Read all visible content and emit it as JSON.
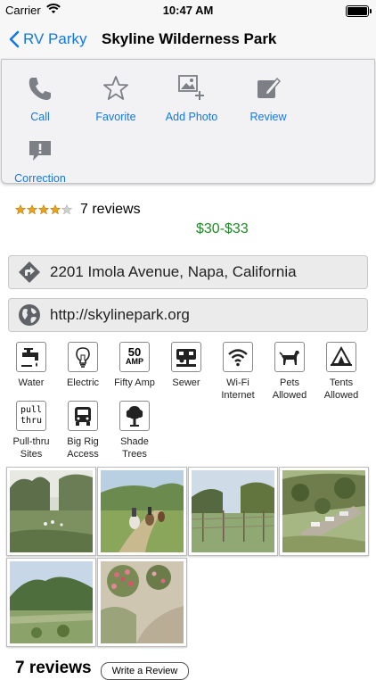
{
  "status_bar": {
    "carrier": "Carrier",
    "time": "10:47 AM"
  },
  "nav": {
    "back_label": "RV Parky",
    "title": "Skyline Wilderness Park"
  },
  "actions": [
    {
      "label": "Call",
      "icon": "phone-icon"
    },
    {
      "label": "Favorite",
      "icon": "star-icon"
    },
    {
      "label": "Add Photo",
      "icon": "add-photo-icon"
    },
    {
      "label": "Review",
      "icon": "review-icon"
    },
    {
      "label": "Correction",
      "icon": "correction-icon"
    }
  ],
  "rating": {
    "stars": 4,
    "max_stars": 5,
    "review_count": "7 reviews"
  },
  "price": "$30-$33",
  "address": "2201 Imola Avenue, Napa, California",
  "website": "http://skylinepark.org",
  "amenities": [
    {
      "label": "Water",
      "icon": "water-faucet-icon"
    },
    {
      "label": "Electric",
      "icon": "lightbulb-icon"
    },
    {
      "label": "Fifty Amp",
      "icon": "fifty-amp-icon",
      "icon_text_top": "50",
      "icon_text_bottom": "AMP"
    },
    {
      "label": "Sewer",
      "icon": "sewer-icon"
    },
    {
      "label": "Wi-Fi Internet",
      "icon": "wifi-icon"
    },
    {
      "label": "Pets Allowed",
      "icon": "pet-icon"
    },
    {
      "label": "Tents Allowed",
      "icon": "tent-icon"
    },
    {
      "label": "Pull-thru Sites",
      "icon": "pull-thru-icon",
      "icon_text_top": "pull",
      "icon_text_bottom": "thru"
    },
    {
      "label": "Big Rig Access",
      "icon": "big-rig-icon"
    },
    {
      "label": "Shade Trees",
      "icon": "tree-icon"
    }
  ],
  "photos": [
    {
      "name": "meadow-photo"
    },
    {
      "name": "horse-riders-photo"
    },
    {
      "name": "field-fence-photo"
    },
    {
      "name": "campground-hillside-photo"
    },
    {
      "name": "valley-mountain-photo"
    },
    {
      "name": "rose-garden-photo"
    }
  ],
  "reviews_section": {
    "heading": "7 reviews",
    "write_button": "Write a Review"
  },
  "colors": {
    "accent": "#1477e6",
    "price": "#1f8c25",
    "star": "#e8a21d"
  }
}
